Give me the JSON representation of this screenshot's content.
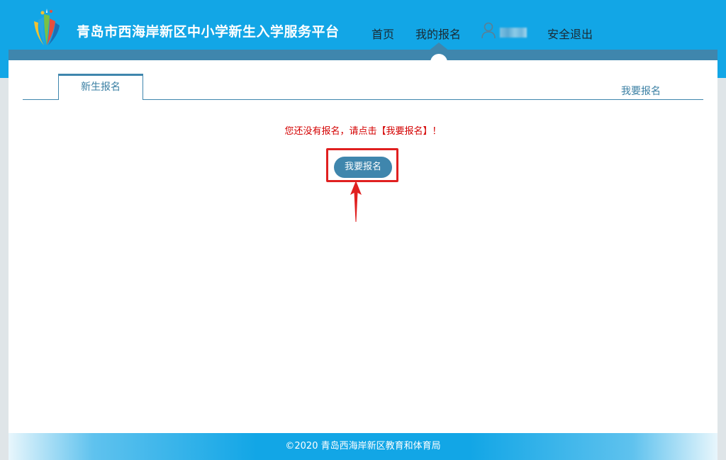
{
  "header": {
    "site_title": "青岛市西海岸新区中小学新生入学服务平台",
    "nav": {
      "home": "首页",
      "my_registration": "我的报名",
      "logout": "安全退出"
    },
    "user_icon": "user-icon",
    "brand_color": "#12a6e6",
    "accent_color": "#3f86ad"
  },
  "tabs": {
    "active_label": "新生报名",
    "right_link": "我要报名"
  },
  "main": {
    "notice": "您还没有报名，请点击【我要报名】！",
    "register_button": "我要报名",
    "notice_color": "#d40000",
    "highlight_color": "#e02020"
  },
  "footer": {
    "copyright": "©2020 青岛西海岸新区教育和体育局"
  }
}
